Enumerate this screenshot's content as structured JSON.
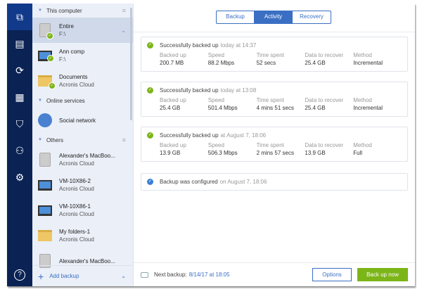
{
  "nav": {
    "items": [
      "backup-icon",
      "archive-icon",
      "sync-icon",
      "tools-icon",
      "protection-icon",
      "account-icon",
      "settings-icon"
    ],
    "help": "?"
  },
  "list": {
    "sections": [
      {
        "label": "This computer",
        "items": [
          {
            "name": "Entire",
            "sub": "F:\\",
            "icon": "disk",
            "ok": true,
            "selected": true
          },
          {
            "name": "Ann comp",
            "sub": "F:\\",
            "icon": "monitor",
            "ok": true
          },
          {
            "name": "Documents",
            "sub": "Acronis Cloud",
            "icon": "folder",
            "ok": true
          }
        ]
      },
      {
        "label": "Online services",
        "items": [
          {
            "name": "Social network",
            "icon": "globe"
          }
        ]
      },
      {
        "label": "Others",
        "items": [
          {
            "name": "Alexander's MacBoo...",
            "sub": "Acronis Cloud",
            "icon": "disk"
          },
          {
            "name": "VM-10X86-2",
            "sub": "Acronis Cloud",
            "icon": "monitor"
          },
          {
            "name": "VM-10X86-1",
            "sub": "Acronis Cloud",
            "icon": "monitor"
          },
          {
            "name": "My folders-1",
            "sub": "Acronis Cloud",
            "icon": "folder"
          },
          {
            "name": "Alexander's MacBoo...",
            "icon": "disk"
          }
        ]
      }
    ],
    "add_backup": "Add backup"
  },
  "tabs": [
    {
      "label": "Backup"
    },
    {
      "label": "Activity",
      "active": true
    },
    {
      "label": "Recovery"
    }
  ],
  "column_labels": [
    "Backed up",
    "Speed",
    "Time spent",
    "Data to recover",
    "Method"
  ],
  "activity": [
    {
      "status": "Successfully backed up",
      "when": "today at 14:37",
      "values": [
        "200.7 MB",
        "88.2 Mbps",
        "52 secs",
        "25.4 GB",
        "Incremental"
      ]
    },
    {
      "status": "Successfully backed up",
      "when": "today at 13:08",
      "values": [
        "25.4 GB",
        "501.4 Mbps",
        "4 mins 51 secs",
        "25.4 GB",
        "Incremental"
      ]
    },
    {
      "status": "Successfully backed up",
      "when": "at August 7, 18:06",
      "values": [
        "13.9 GB",
        "506.3 Mbps",
        "2 mins 57 secs",
        "13.9 GB",
        "Full"
      ]
    },
    {
      "status": "Backup was configured",
      "when": "on August 7, 18:06"
    }
  ],
  "footer": {
    "next_label": "Next backup:",
    "next_value": "8/14/17 at 18:05",
    "options": "Options",
    "back_up_now": "Back up now"
  },
  "colors": {
    "accent": "#3a6fc4",
    "success": "#7cb518",
    "nav": "#0a2354"
  }
}
